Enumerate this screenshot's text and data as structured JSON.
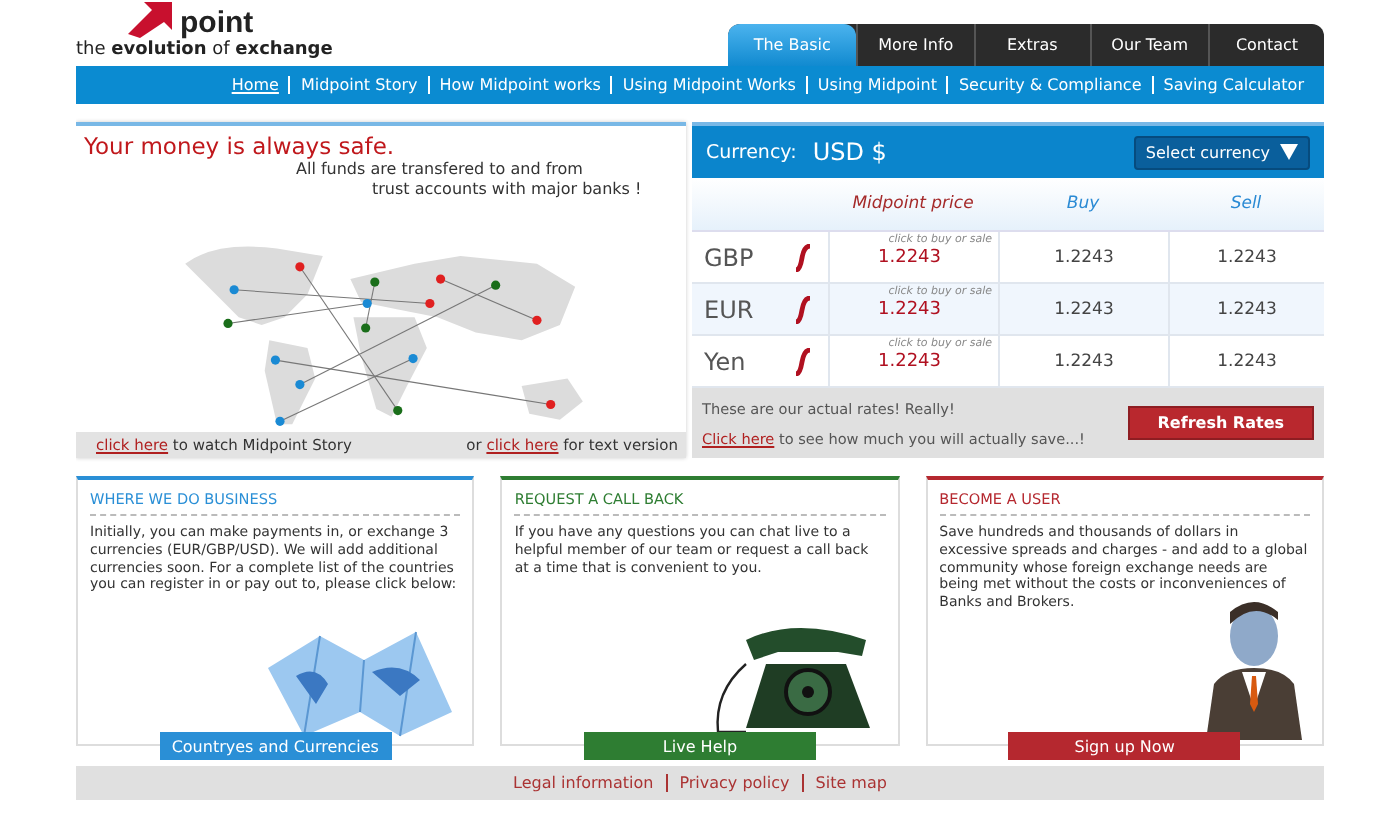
{
  "logo": {
    "word": "point",
    "tagline": "the **evolution** of **exchange**"
  },
  "tabs": [
    {
      "label": "The Basic",
      "selected": true
    },
    {
      "label": "More Info",
      "selected": false
    },
    {
      "label": "Extras",
      "selected": false
    },
    {
      "label": "Our Team",
      "selected": false
    },
    {
      "label": "Contact",
      "selected": false
    }
  ],
  "nav": [
    {
      "label": "Home",
      "selected": true
    },
    {
      "label": "Midpoint Story",
      "selected": false
    },
    {
      "label": "How Midpoint works",
      "selected": false
    },
    {
      "label": "Using Midpoint Works",
      "selected": false
    },
    {
      "label": "Using Midpoint",
      "selected": false
    },
    {
      "label": "Security & Compliance",
      "selected": false
    },
    {
      "label": "Saving Calculator",
      "selected": false
    }
  ],
  "hero": {
    "title": "Your money is always safe.",
    "subtitle": [
      "All funds are transfered to and from",
      "trust accounts with major banks !"
    ],
    "left_link": "click here",
    "left_text": "to watch Midpoint Story",
    "right_prefix": "or",
    "right_link": "click here",
    "right_text": "for text version"
  },
  "rates": {
    "currency_label": "Currency:",
    "currency": "USD $",
    "select": "Select currency",
    "columns": [
      "Midpoint price",
      "Buy",
      "Sell"
    ],
    "rows": [
      {
        "code": "GBP",
        "hint": "click to buy or sale",
        "mid": "1.2243",
        "buy": "1.2243",
        "sell": "1.2243"
      },
      {
        "code": "EUR",
        "hint": "click to buy or sale",
        "mid": "1.2243",
        "buy": "1.2243",
        "sell": "1.2243"
      },
      {
        "code": "Yen",
        "hint": "click to buy or sale",
        "mid": "1.2243",
        "buy": "1.2243",
        "sell": "1.2243"
      }
    ],
    "note": "These are our actual rates! Really!",
    "link": "Click here",
    "link_text": "to see how much you will actually save...!",
    "button": "Refresh Rates"
  },
  "cards": [
    {
      "kind": "map",
      "color": "#2a8fd6",
      "title": "WHERE WE DO BUSINESS",
      "text": "Initially, you can make payments in, or exchange 3 currencies (EUR/GBP/USD). We will add additional currencies soon. For a complete list of the countries you can register in or pay out to, please click below:",
      "button": "Countryes and Currencies"
    },
    {
      "kind": "phone",
      "color": "#2e7d32",
      "title": "REQUEST A CALL BACK",
      "text": "If you have any questions you can chat live to a helpful member of our team or request a call back at a time that is convenient to you.",
      "button": "Live Help"
    },
    {
      "kind": "person",
      "color": "#b5282f",
      "title": "BECOME A USER",
      "text": "Save hundreds and thousands of dollars in excessive spreads and charges - and add to a global community whose foreign exchange needs are being met without the costs or inconveniences of Banks and Brokers.",
      "button": "Sign up Now"
    }
  ],
  "footer": [
    "Legal information",
    "Privacy policy",
    "Site map"
  ]
}
